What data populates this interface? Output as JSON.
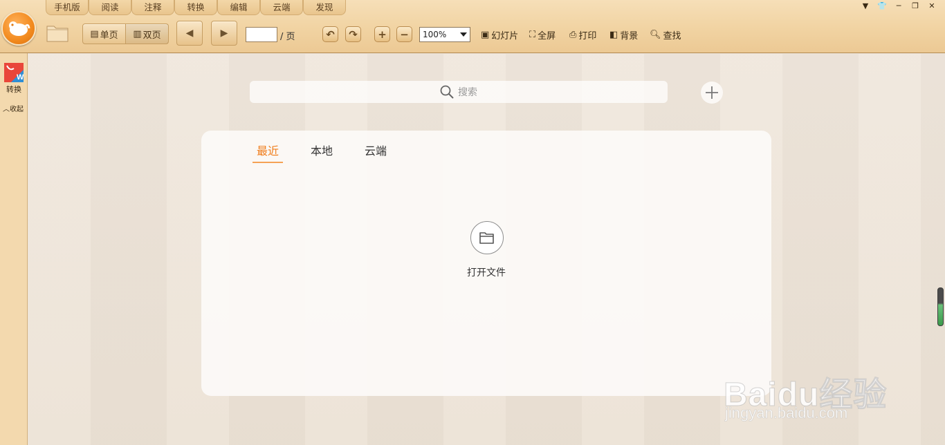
{
  "menu_tabs": [
    "手机版",
    "阅读",
    "注释",
    "转换",
    "编辑",
    "云端",
    "发现"
  ],
  "toolbar": {
    "single_page": "单页",
    "double_page": "双页",
    "page_value": "",
    "page_suffix": "/ 页",
    "zoom": "100%",
    "slideshow": "幻灯片",
    "fullscreen": "全屏",
    "print": "打印",
    "background": "背景",
    "find": "查找"
  },
  "sidebar": {
    "convert_label": "转换",
    "collapse_label": "收起"
  },
  "search": {
    "placeholder": "搜索"
  },
  "panel": {
    "tabs": [
      "最近",
      "本地",
      "云端"
    ],
    "active_tab": "最近",
    "open_file_label": "打开文件"
  },
  "watermark": {
    "brand": "Baidu经验",
    "url": "jingyan.baidu.com"
  },
  "colors": {
    "accent": "#f07d1c",
    "toolbar": "#f1d3a2",
    "sidebar": "#f3d9ae"
  }
}
